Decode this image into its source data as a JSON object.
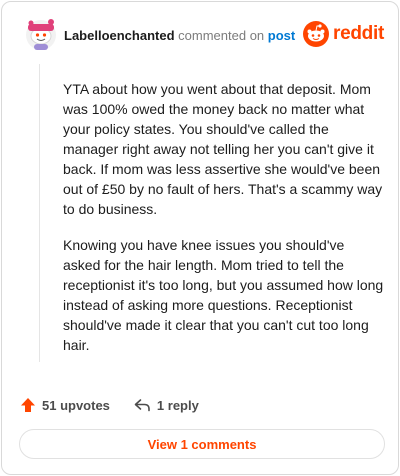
{
  "header": {
    "username": "Labelloenchanted",
    "verb": "commented on",
    "post_link": "post",
    "avatar_icon": "snoo-avatar-icon",
    "logo_icon": "reddit-snoo-icon",
    "logo_text": "reddit"
  },
  "comment": {
    "paragraphs": [
      "YTA about how you went about that deposit. Mom was 100% owed the money back no matter what your policy states. You should've called the manager right away not telling her you can't give it back. If mom was less assertive she would've been out of £50 by no fault of hers. That's a scammy way to do business.",
      "Knowing you have knee issues you should've asked for the hair length. Mom tried to tell the receptionist it's too long, but you assumed how long instead of asking more questions. Receptionist should've made it clear that you can't cut too long hair."
    ]
  },
  "actions": {
    "upvotes_label": "51 upvotes",
    "upvote_icon": "upvote-arrow-icon",
    "reply_label": "1 reply",
    "reply_icon": "reply-arrow-icon"
  },
  "view_comments_label": "View 1 comments",
  "colors": {
    "accent": "#ff4500",
    "link": "#0079d3",
    "muted": "#7c7c7c"
  }
}
